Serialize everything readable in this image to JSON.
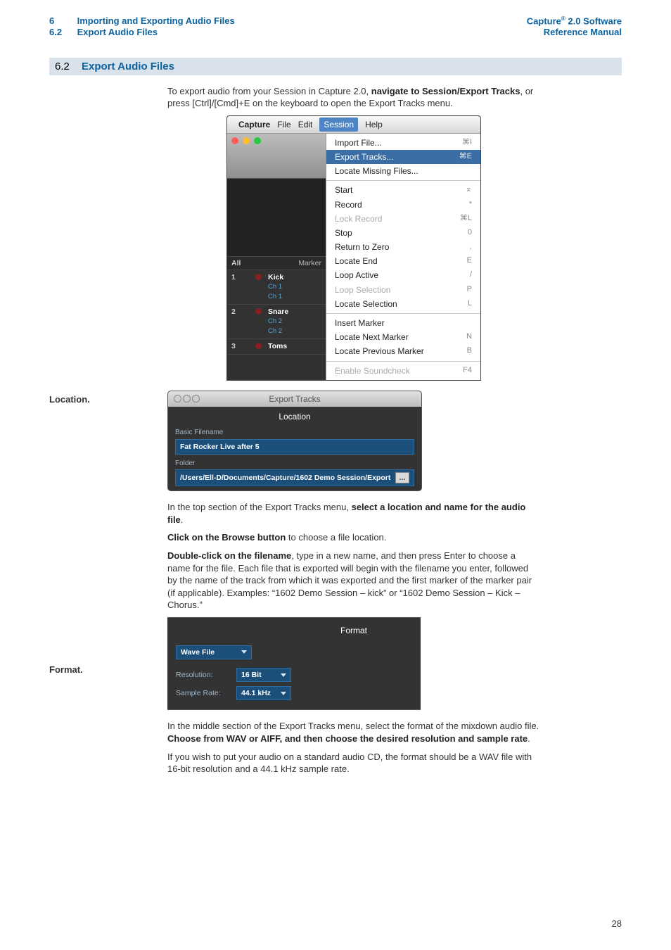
{
  "header": {
    "chapter_num": "6",
    "chapter_title": "Importing and Exporting Audio Files",
    "section_num": "6.2",
    "section_title": "Export Audio Files",
    "product_line1": "Capture",
    "product_sup": "®",
    "product_line1b": " 2.0 Software",
    "product_line2": "Reference Manual"
  },
  "section_bar": {
    "num": "6.2",
    "title": "Export Audio Files"
  },
  "intro": {
    "pre": "To export audio from your Session in Capture 2.0, ",
    "bold": "navigate to Session/Export Tracks",
    "post": ", or press [Ctrl]/[Cmd]+E on the keyboard to open the Export Tracks menu."
  },
  "fig1": {
    "macbar": {
      "apple": "",
      "app": "Capture",
      "file": "File",
      "edit": "Edit",
      "session": "Session",
      "help": "Help"
    },
    "menu": {
      "import": "Import File...",
      "import_sc": "⌘I",
      "export": "Export Tracks...",
      "export_sc": "⌘E",
      "locate_missing": "Locate Missing Files...",
      "start": "Start",
      "start_sc": "⌅",
      "record": "Record",
      "record_sc": "*",
      "lock_record": "Lock Record",
      "lock_record_sc": "⌘L",
      "stop": "Stop",
      "stop_sc": "0",
      "rtz": "Return to Zero",
      "rtz_sc": ",",
      "locate_end": "Locate End",
      "locate_end_sc": "E",
      "loop_active": "Loop Active",
      "loop_active_sc": "/",
      "loop_sel": "Loop Selection",
      "loop_sel_sc": "P",
      "locate_sel": "Locate Selection",
      "locate_sel_sc": "L",
      "ins_marker": "Insert Marker",
      "next_marker": "Locate Next Marker",
      "next_marker_sc": "N",
      "prev_marker": "Locate Previous Marker",
      "prev_marker_sc": "B",
      "soundcheck": "Enable Soundcheck",
      "soundcheck_sc": "F4"
    },
    "tracks": {
      "all": "All",
      "marker": "Marker",
      "t1_num": "1",
      "t1_name": "Kick",
      "t1_cha": "Ch 1",
      "t1_chb": "Ch 1",
      "t2_num": "2",
      "t2_name": "Snare",
      "t2_cha": "Ch 2",
      "t2_chb": "Ch 2",
      "t3_num": "3",
      "t3_name": "Toms"
    }
  },
  "loc_heading": "Location.",
  "fig2": {
    "title": "Export Tracks",
    "section": "Location",
    "basic_label": "Basic Filename",
    "basic_value": "Fat Rocker Live after 5",
    "folder_label": "Folder",
    "folder_value": "/Users/Ell-D/Documents/Capture/1602 Demo Session/Export",
    "browse": "..."
  },
  "loc_p1_pre": "In the top section of the Export Tracks menu, ",
  "loc_p1_bold": "select a location and name for the audio file",
  "loc_p1_post": ".",
  "loc_p2_bold": "Click on the Browse button",
  "loc_p2_post": " to choose a file location.",
  "loc_p3_bold": "Double-click on the filename",
  "loc_p3_post": ", type in a new name, and then press Enter to choose a name for the file. Each file that is exported will begin with the filename you enter, followed by the name of the track from which it was exported and the first marker of the marker pair (if applicable). Examples: “1602 Demo Session – kick” or “1602 Demo Session – Kick – Chorus.”",
  "fmt_heading": "Format.",
  "fig3": {
    "section": "Format",
    "filetype": "Wave File",
    "res_label": "Resolution:",
    "res_value": "16 Bit",
    "rate_label": "Sample Rate:",
    "rate_value": "44.1 kHz"
  },
  "fmt_p1_pre": "In the middle section of the Export Tracks menu, select the format of the mixdown audio file. ",
  "fmt_p1_bold": "Choose from WAV or AIFF, and then choose the desired resolution and sample rate",
  "fmt_p1_post": ".",
  "fmt_p2": "If you wish to put your audio on a standard audio CD, the format should be a WAV file with 16-bit resolution and a 44.1 kHz sample rate.",
  "page_num": "28"
}
